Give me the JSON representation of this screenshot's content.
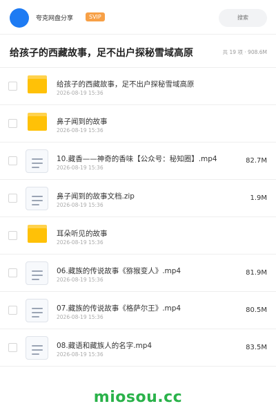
{
  "header": {
    "username": "夸克网盘分享",
    "badge": "SVIP",
    "search_placeholder": "搜索",
    "accent_color": "#1e7bf3",
    "badge_color": "#f7a046"
  },
  "folder_title": "给孩子的西藏故事，足不出户探秘雪域高原",
  "folder_meta": "共 19 项 · 908.6M",
  "items": [
    {
      "type": "folder-icon",
      "name": "给孩子的西藏故事，足不出户探秘雪域高原",
      "date": "2026-08-19 15:36",
      "size": ""
    },
    {
      "type": "folder-icon",
      "name": "鼻子闻到的故事",
      "date": "2026-08-19 15:36",
      "size": ""
    },
    {
      "type": "file-icon",
      "name": "10.藏香——神奇的香味【公众号：秘知圈】.mp4",
      "date": "2026-08-19 15:36",
      "size": "82.7M"
    },
    {
      "type": "file-icon",
      "name": "鼻子闻到的故事文档.zip",
      "date": "2026-08-19 15:36",
      "size": "1.9M"
    },
    {
      "type": "folder-icon",
      "name": "耳朵听见的故事",
      "date": "2026-08-19 15:36",
      "size": ""
    },
    {
      "type": "file-icon",
      "name": "06.藏族的传说故事《猕猴变人》.mp4",
      "date": "2026-08-19 15:36",
      "size": "81.9M"
    },
    {
      "type": "file-icon",
      "name": "07.藏族的传说故事《格萨尔王》.mp4",
      "date": "2026-08-19 15:36",
      "size": "80.5M"
    },
    {
      "type": "file-icon",
      "name": "08.藏语和藏族人的名字.mp4",
      "date": "2026-08-19 15:36",
      "size": "83.5M"
    }
  ],
  "watermark": "miosou.cc"
}
